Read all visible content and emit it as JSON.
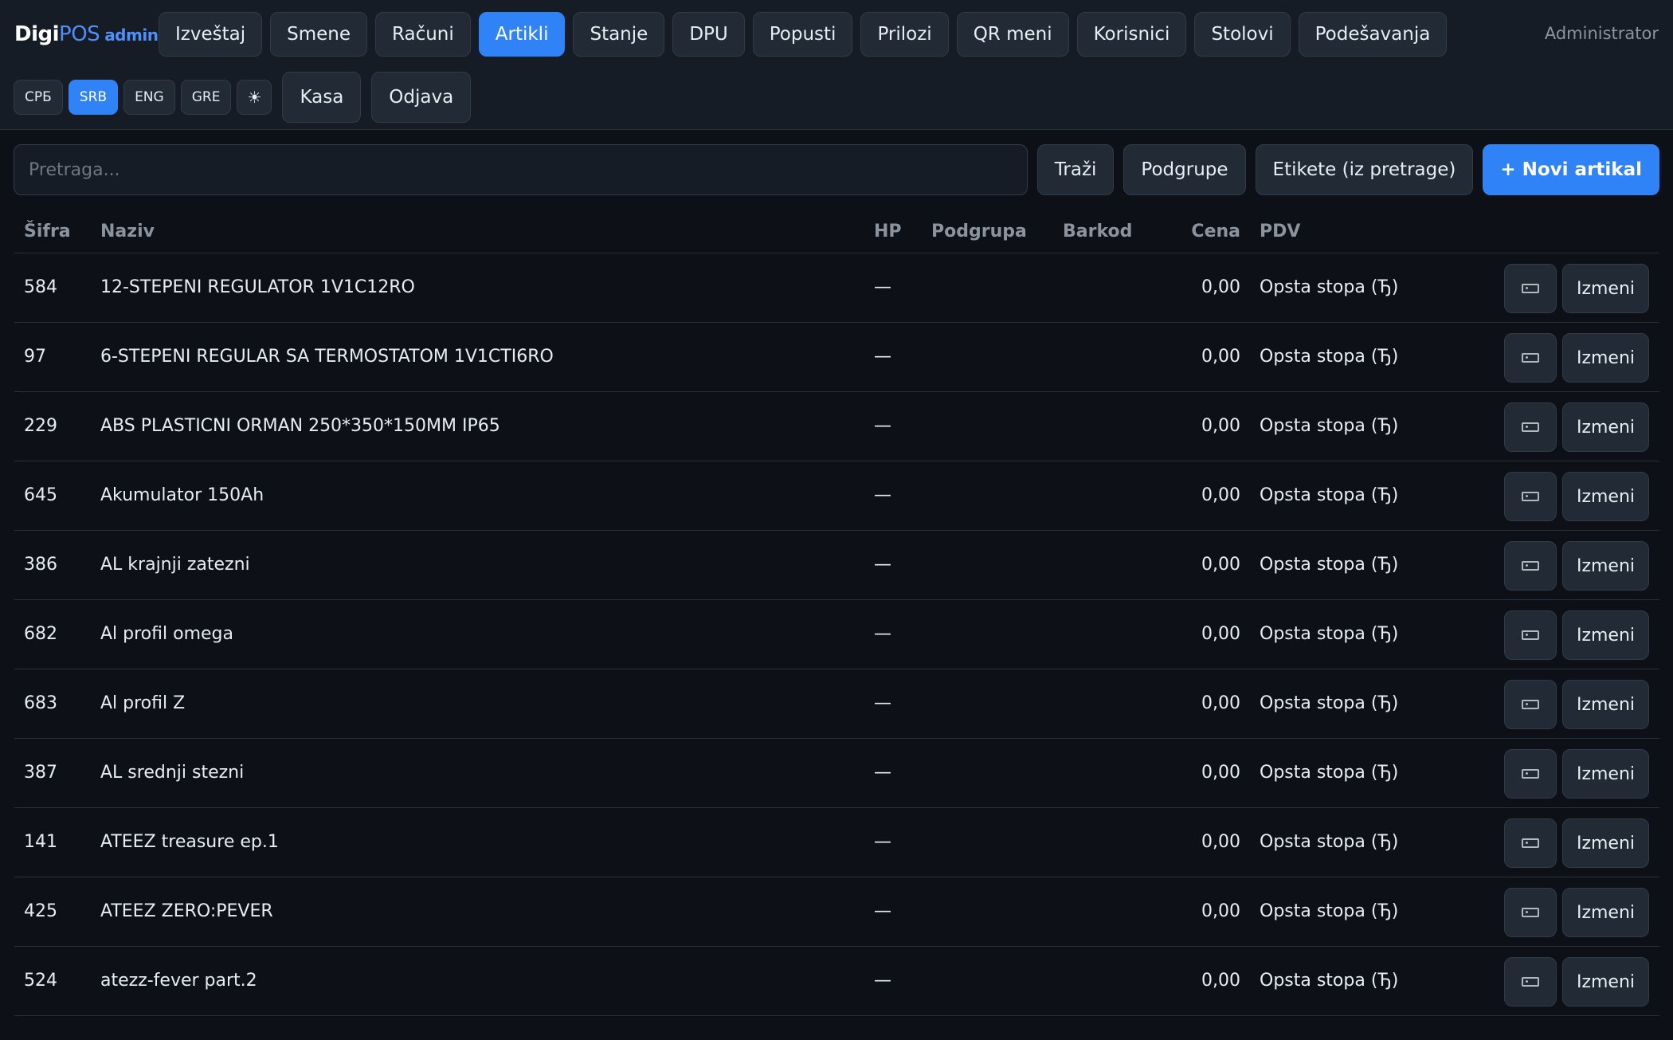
{
  "brand": {
    "part1": "Digi",
    "part2": "POS",
    "part3": "admin"
  },
  "nav": [
    {
      "label": "Izveštaj",
      "active": false
    },
    {
      "label": "Smene",
      "active": false
    },
    {
      "label": "Računi",
      "active": false
    },
    {
      "label": "Artikli",
      "active": true
    },
    {
      "label": "Stanje",
      "active": false
    },
    {
      "label": "DPU",
      "active": false
    },
    {
      "label": "Popusti",
      "active": false
    },
    {
      "label": "Prilozi",
      "active": false
    },
    {
      "label": "QR meni",
      "active": false
    },
    {
      "label": "Korisnici",
      "active": false
    },
    {
      "label": "Stolovi",
      "active": false
    },
    {
      "label": "Podešavanja",
      "active": false
    }
  ],
  "user": {
    "label": "Administrator"
  },
  "languages": [
    {
      "label": "СРБ",
      "active": false
    },
    {
      "label": "SRB",
      "active": true
    },
    {
      "label": "ENG",
      "active": false
    },
    {
      "label": "GRE",
      "active": false
    }
  ],
  "theme_toggle": {
    "label": "☀",
    "icon": "sun-icon"
  },
  "actions": {
    "kasa": "Kasa",
    "odjava": "Odjava"
  },
  "toolbar": {
    "search_placeholder": "Pretraga...",
    "search_value": "",
    "search_button": "Traži",
    "subgroups_button": "Podgrupe",
    "labels_button": "Etikete (iz pretrage)",
    "new_button": "+ Novi artikal"
  },
  "table": {
    "columns": {
      "sifra": "Šifra",
      "naziv": "Naziv",
      "hp": "HP",
      "podgrupa": "Podgrupa",
      "barkod": "Barkod",
      "cena": "Cena",
      "pdv": "PDV"
    },
    "edit_label": "Izmeni",
    "label_icon": "tag-icon",
    "rows": [
      {
        "sifra": "584",
        "naziv": "12-STEPENI REGULATOR 1V1C12RO",
        "hp": "—",
        "podgrupa": "",
        "barkod": "",
        "cena": "0,00",
        "pdv": "Opsta stopa (Ђ)"
      },
      {
        "sifra": "97",
        "naziv": "6-STEPENI REGULAR SA TERMOSTATOM 1V1CTI6RO",
        "hp": "—",
        "podgrupa": "",
        "barkod": "",
        "cena": "0,00",
        "pdv": "Opsta stopa (Ђ)"
      },
      {
        "sifra": "229",
        "naziv": "ABS PLASTICNI ORMAN 250*350*150MM IP65",
        "hp": "—",
        "podgrupa": "",
        "barkod": "",
        "cena": "0,00",
        "pdv": "Opsta stopa (Ђ)"
      },
      {
        "sifra": "645",
        "naziv": "Akumulator 150Ah",
        "hp": "—",
        "podgrupa": "",
        "barkod": "",
        "cena": "0,00",
        "pdv": "Opsta stopa (Ђ)"
      },
      {
        "sifra": "386",
        "naziv": "AL krajnji zatezni",
        "hp": "—",
        "podgrupa": "",
        "barkod": "",
        "cena": "0,00",
        "pdv": "Opsta stopa (Ђ)"
      },
      {
        "sifra": "682",
        "naziv": "Al profil omega",
        "hp": "—",
        "podgrupa": "",
        "barkod": "",
        "cena": "0,00",
        "pdv": "Opsta stopa (Ђ)"
      },
      {
        "sifra": "683",
        "naziv": "Al profil Z",
        "hp": "—",
        "podgrupa": "",
        "barkod": "",
        "cena": "0,00",
        "pdv": "Opsta stopa (Ђ)"
      },
      {
        "sifra": "387",
        "naziv": "AL srednji stezni",
        "hp": "—",
        "podgrupa": "",
        "barkod": "",
        "cena": "0,00",
        "pdv": "Opsta stopa (Ђ)"
      },
      {
        "sifra": "141",
        "naziv": "ATEEZ treasure ep.1",
        "hp": "—",
        "podgrupa": "",
        "barkod": "",
        "cena": "0,00",
        "pdv": "Opsta stopa (Ђ)"
      },
      {
        "sifra": "425",
        "naziv": "ATEEZ ZERO:PEVER",
        "hp": "—",
        "podgrupa": "",
        "barkod": "",
        "cena": "0,00",
        "pdv": "Opsta stopa (Ђ)"
      },
      {
        "sifra": "524",
        "naziv": "atezz-fever part.2",
        "hp": "—",
        "podgrupa": "",
        "barkod": "",
        "cena": "0,00",
        "pdv": "Opsta stopa (Ђ)"
      }
    ]
  },
  "colors": {
    "accent": "#2f83f7",
    "background": "#0d1117",
    "header": "#161c25",
    "button": "#222a35"
  }
}
